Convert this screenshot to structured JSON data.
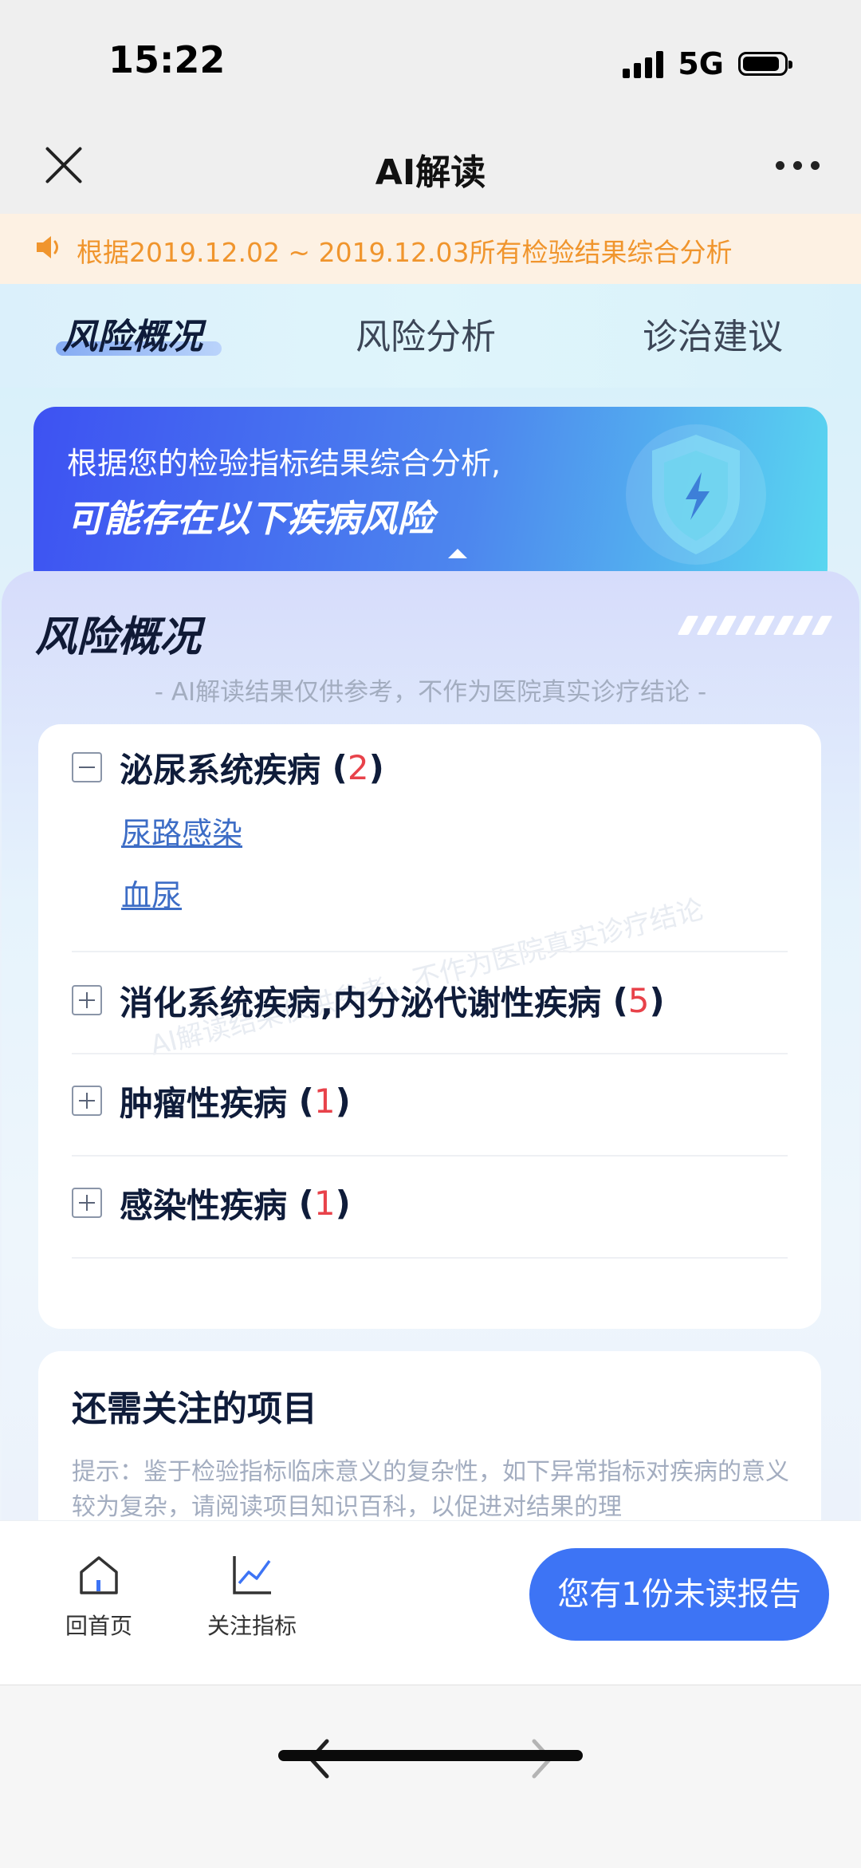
{
  "status_bar": {
    "time": "15:22",
    "network": "5G"
  },
  "nav": {
    "title": "AI解读"
  },
  "notice": {
    "text": "根据2019.12.02 ~ 2019.12.03所有检验结果综合分析"
  },
  "tabs": [
    {
      "label": "风险概况",
      "active": true
    },
    {
      "label": "风险分析",
      "active": false
    },
    {
      "label": "诊治建议",
      "active": false
    }
  ],
  "banner": {
    "line1": "根据您的检验指标结果综合分析,",
    "line2": "可能存在以下疾病风险"
  },
  "panel": {
    "title": "风险概况",
    "disclaimer": "- AI解读结果仅供参考，不作为医院真实诊疗结论 -",
    "watermark": "AI解读结果仅供参考，不作为医院真实诊疗结论"
  },
  "categories": [
    {
      "name": "泌尿系统疾病",
      "count": "2",
      "expanded": true,
      "items": [
        "尿路感染",
        "血尿"
      ]
    },
    {
      "name": "消化系统疾病,内分泌代谢性疾病",
      "count": "5",
      "expanded": false
    },
    {
      "name": "肿瘤性疾病",
      "count": "1",
      "expanded": false
    },
    {
      "name": "感染性疾病",
      "count": "1",
      "expanded": false
    }
  ],
  "attention": {
    "title": "还需关注的项目",
    "tip": "提示：鉴于检验指标临床意义的复杂性，如下异常指标对疾病的意义较为复杂，请阅读项目知识百科，以促进对结果的理"
  },
  "bottom_bar": {
    "home_label": "回首页",
    "indicators_label": "关注指标",
    "unread_button": "您有1份未读报告"
  },
  "colors": {
    "accent": "#3d74f5",
    "count_red": "#e8424a",
    "notice_orange": "#f0952d"
  }
}
